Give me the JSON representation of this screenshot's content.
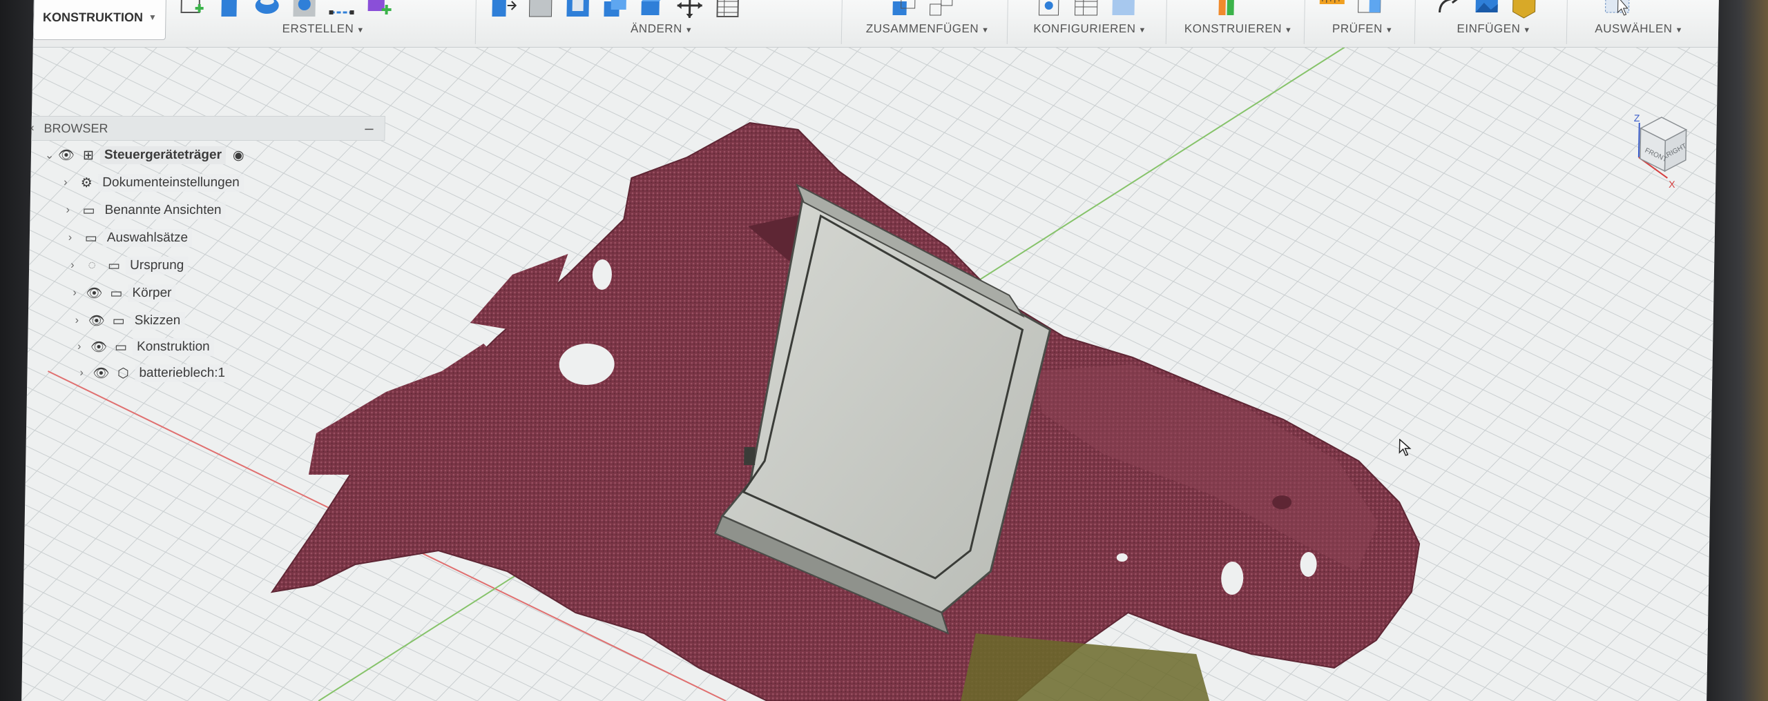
{
  "toolbar": {
    "workspace_label": "KONSTRUKTION",
    "groups": [
      {
        "label": "ERSTELLEN",
        "icons": [
          "new-sketch-icon",
          "extrude-icon",
          "revolve-icon",
          "hole-icon",
          "line-tool-icon",
          "create-form-icon"
        ]
      },
      {
        "label": "ÄNDERN",
        "icons": [
          "press-pull-icon",
          "fillet-icon",
          "shell-icon",
          "combine-icon",
          "offset-face-icon",
          "move-icon",
          "parameters-icon"
        ]
      },
      {
        "label": "ZUSAMMENFÜGEN",
        "icons": [
          "new-component-icon",
          "joint-icon"
        ]
      },
      {
        "label": "KONFIGURIEREN",
        "icons": [
          "configure-icon",
          "table-icon",
          "config-rule-icon"
        ]
      },
      {
        "label": "KONSTRUIEREN",
        "icons": [
          "offset-plane-icon"
        ]
      },
      {
        "label": "PRÜFEN",
        "icons": [
          "measure-icon",
          "section-analysis-icon"
        ]
      },
      {
        "label": "EINFÜGEN",
        "icons": [
          "insert-derive-icon",
          "insert-image-icon",
          "insert-mesh-icon"
        ]
      },
      {
        "label": "AUSWÄHLEN",
        "icons": [
          "select-icon"
        ]
      }
    ]
  },
  "browser": {
    "title": "BROWSER",
    "root": "Steuergeräteträger",
    "items": [
      {
        "label": "Dokumenteinstellungen",
        "icon": "gear-icon",
        "visible": null
      },
      {
        "label": "Benannte Ansichten",
        "icon": "folder-icon",
        "visible": null
      },
      {
        "label": "Auswahlsätze",
        "icon": "folder-icon",
        "visible": null
      },
      {
        "label": "Ursprung",
        "icon": "folder-icon",
        "visible": false
      },
      {
        "label": "Körper",
        "icon": "folder-icon",
        "visible": true
      },
      {
        "label": "Skizzen",
        "icon": "folder-icon",
        "visible": true
      },
      {
        "label": "Konstruktion",
        "icon": "folder-icon",
        "visible": true
      },
      {
        "label": "batterieblech:1",
        "icon": "body-icon",
        "visible": true
      }
    ]
  },
  "viewcube": {
    "faces": [
      "FRONT",
      "RIGHT"
    ],
    "axes": [
      "Z",
      "X"
    ]
  },
  "colors": {
    "mesh": "#7a3546",
    "mesh_light": "#9c5264",
    "plate": "#c9ccc7",
    "grid": "#c6cbcd",
    "axis_x": "#e07070",
    "axis_y": "#86c36a",
    "mesh_yellow": "#6b6a2a"
  }
}
